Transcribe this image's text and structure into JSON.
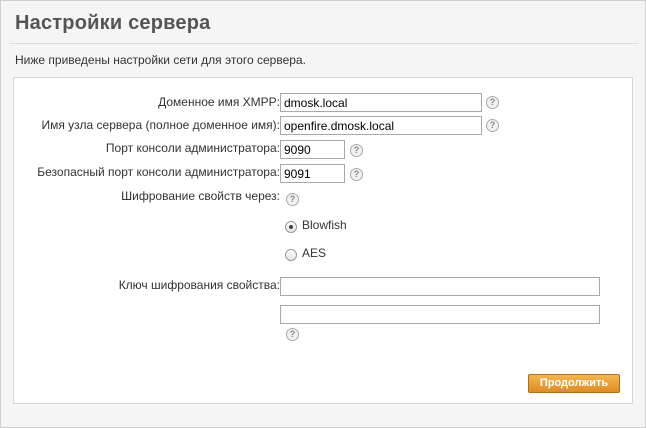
{
  "page": {
    "title": "Настройки сервера",
    "description": "Ниже приведены настройки сети для этого сервера."
  },
  "form": {
    "xmpp_domain": {
      "label": "Доменное имя XMPP:",
      "value": "dmosk.local"
    },
    "server_hostname": {
      "label": "Имя узла сервера (полное доменное имя):",
      "value": "openfire.dmosk.local"
    },
    "admin_console_port": {
      "label": "Порт консоли администратора:",
      "value": "9090"
    },
    "secure_admin_console_port": {
      "label": "Безопасный порт консоли администратора:",
      "value": "9091"
    },
    "encryption": {
      "label": "Шифрование свойств через:",
      "options": [
        {
          "label": "Blowfish",
          "checked": true
        },
        {
          "label": "AES",
          "checked": false
        }
      ]
    },
    "encryption_key": {
      "label": "Ключ шифрования свойства:",
      "value": "",
      "confirm_value": ""
    },
    "help_glyph": "?",
    "help_icon": "question-circle-icon"
  },
  "actions": {
    "continue_label": "Продолжить",
    "accent_color": "#e39a33"
  }
}
